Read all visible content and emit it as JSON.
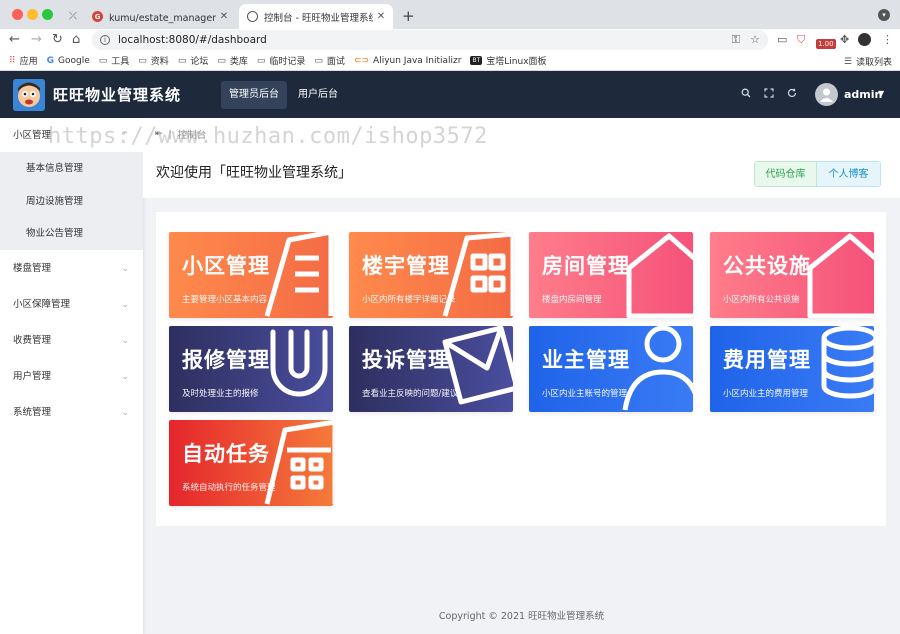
{
  "browser": {
    "tabs": [
      {
        "title": "kumu/estate_management - 码",
        "close": "✕"
      },
      {
        "title": "控制台 - 旺旺物业管理系统",
        "close": "✕"
      }
    ],
    "new_tab": "+",
    "url": "localhost:8080/#/dashboard",
    "badge": "1.00",
    "bookmarks": [
      "应用",
      "Google",
      "工具",
      "资料",
      "论坛",
      "类库",
      "临时记录",
      "面试",
      "Aliyun Java Initializr",
      "宝塔Linux面板"
    ],
    "bt_label": "BT",
    "reading_list": "读取列表"
  },
  "header": {
    "title": "旺旺物业管理系统",
    "nav": [
      "管理员后台",
      "用户后台"
    ],
    "user": "admin"
  },
  "sidebar": {
    "groups": [
      {
        "label": "小区管理",
        "children": [
          "基本信息管理",
          "周边设施管理",
          "物业公告管理"
        ]
      },
      {
        "label": "楼盘管理"
      },
      {
        "label": "小区保障管理"
      },
      {
        "label": "收费管理"
      },
      {
        "label": "用户管理"
      },
      {
        "label": "系统管理"
      }
    ]
  },
  "main": {
    "breadcrumb": "控制台",
    "welcome": "欢迎使用「旺旺物业管理系统」",
    "buttons": [
      "代码仓库",
      "个人博客"
    ],
    "cards": [
      {
        "title": "小区管理",
        "desc": "主要管理小区基本内容",
        "icon": "building-icon",
        "color": "orange"
      },
      {
        "title": "楼宇管理",
        "desc": "小区内所有楼宇详细记录",
        "icon": "building-icon",
        "color": "orange"
      },
      {
        "title": "房间管理",
        "desc": "楼盘内房间管理",
        "icon": "home-icon",
        "color": "pink"
      },
      {
        "title": "公共设施",
        "desc": "小区内所有公共设施",
        "icon": "home-icon",
        "color": "pink"
      },
      {
        "title": "报修管理",
        "desc": "及时处理业主的报修",
        "icon": "magnet-icon",
        "color": "navy"
      },
      {
        "title": "投诉管理",
        "desc": "查看业主反映的问题/建议",
        "icon": "mail-icon",
        "color": "navy"
      },
      {
        "title": "业主管理",
        "desc": "小区内业主账号的管理",
        "icon": "user-icon",
        "color": "blue"
      },
      {
        "title": "费用管理",
        "desc": "小区内业主的费用管理",
        "icon": "coins-icon",
        "color": "blue"
      },
      {
        "title": "自动任务",
        "desc": "系统自动执行的任务管理",
        "icon": "calendar-icon",
        "color": "red"
      }
    ]
  },
  "footer": "Copyright © 2021 旺旺物业管理系统",
  "watermark": "https://www.huzhan.com/ishop3572"
}
